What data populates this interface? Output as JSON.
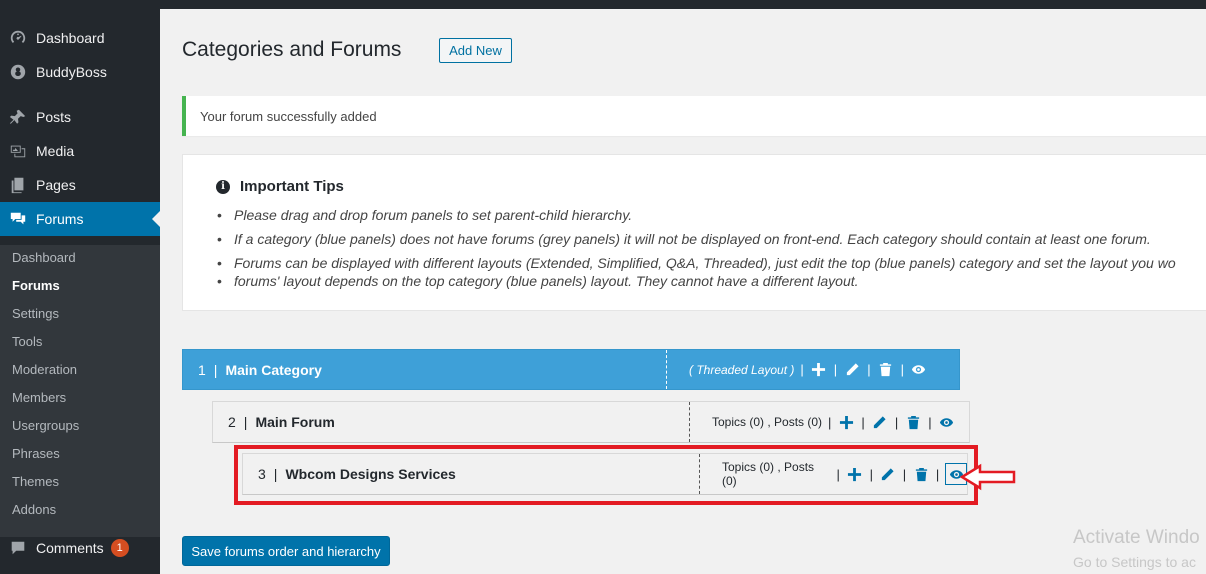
{
  "sidebar": {
    "items": [
      {
        "label": "Dashboard",
        "icon": "dashboard-icon"
      },
      {
        "label": "BuddyBoss",
        "icon": "buddyboss-icon"
      },
      {
        "label": "Posts",
        "icon": "pin-icon"
      },
      {
        "label": "Media",
        "icon": "media-icon"
      },
      {
        "label": "Pages",
        "icon": "pages-icon"
      },
      {
        "label": "Forums",
        "icon": "forums-icon",
        "active": true
      }
    ],
    "submenu": [
      "Dashboard",
      "Forums",
      "Settings",
      "Tools",
      "Moderation",
      "Members",
      "Usergroups",
      "Phrases",
      "Themes",
      "Addons"
    ],
    "submenu_current": "Forums",
    "comments": {
      "label": "Comments",
      "count": "1",
      "icon": "comments-icon"
    }
  },
  "header": {
    "title": "Categories and Forums",
    "add_new": "Add New"
  },
  "notice": {
    "text": "Your forum successfully added",
    "color": "#46b450"
  },
  "tips": {
    "heading": "Important Tips",
    "items": [
      "Please drag and drop forum panels to set parent-child hierarchy.",
      "If a category (blue panels) does not have forums (grey panels) it will not be displayed on front-end. Each category should contain at least one forum.",
      "Forums can be displayed with different layouts (Extended, Simplified, Q&A, Threaded), just edit the top (blue panels) category and set the layout you wo",
      "forums' layout depends on the top category (blue panels) layout. They cannot have a different layout."
    ]
  },
  "panels": {
    "category": {
      "number": "1",
      "name": "Main Category",
      "layout": "( Threaded Layout )",
      "color": "#3ea0d8"
    },
    "forum": {
      "number": "2",
      "name": "Main Forum",
      "stats": "Topics (0) , Posts (0)"
    },
    "subforum": {
      "number": "3",
      "name": "Wbcom Designs Services",
      "stats": "Topics (0) , Posts (0)"
    },
    "separator": "|"
  },
  "actions": {
    "save": "Save forums order and hierarchy"
  },
  "watermark": {
    "line1": "Activate Windo",
    "line2": "Go to Settings to ac"
  },
  "annotation_color": "#e31b23"
}
